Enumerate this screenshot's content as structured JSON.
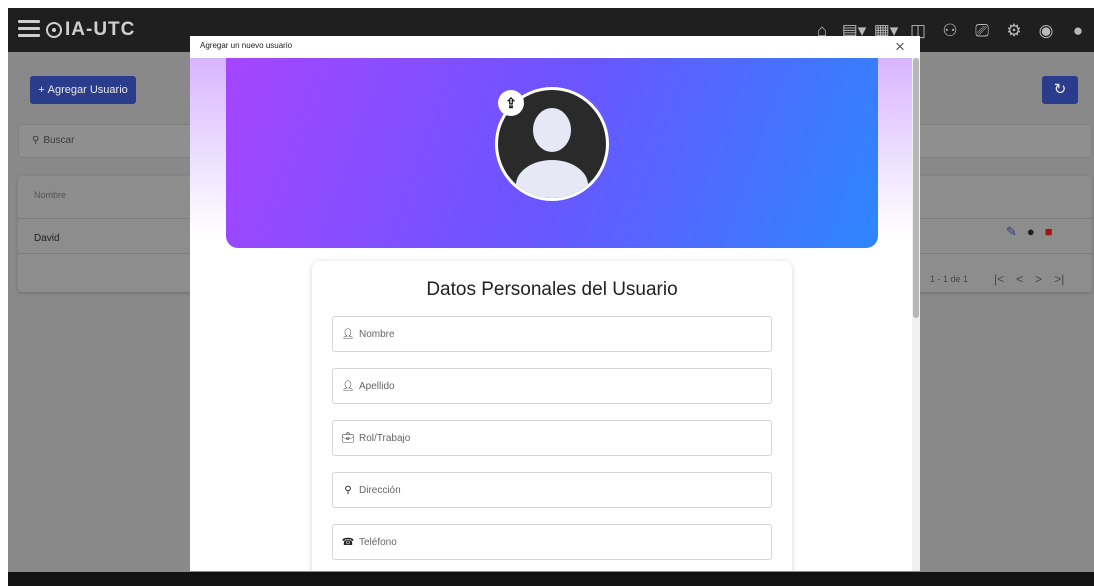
{
  "app": {
    "logo_text": "IA-UTC"
  },
  "toolbar": {
    "add_user_label": "Agregar Usuario",
    "reload_icon": "reload-icon"
  },
  "search": {
    "label": "Buscar"
  },
  "table": {
    "headers": [
      "Nombre"
    ],
    "rows": [
      {
        "name": "David"
      }
    ],
    "pagination": {
      "range_text": "1 - 1 de 1"
    }
  },
  "modal": {
    "title": "Agregar un nuevo usuario",
    "card_title": "Datos Personales del Usuario",
    "fields": [
      {
        "placeholder": "Nombre",
        "icon": "person-icon"
      },
      {
        "placeholder": "Apellido",
        "icon": "person-icon"
      },
      {
        "placeholder": "Rol/Trabajo",
        "icon": "briefcase-icon"
      },
      {
        "placeholder": "Dirección",
        "icon": "location-pin-icon"
      },
      {
        "placeholder": "Teléfono",
        "icon": "phone-icon"
      }
    ]
  },
  "colors": {
    "primary_button": "#2b3c8d",
    "banner_start": "#a545ff",
    "banner_end": "#2d86ff",
    "topbar": "#1f1f1f"
  }
}
